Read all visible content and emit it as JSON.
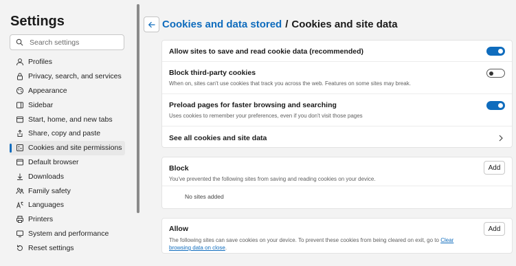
{
  "sidebar": {
    "title": "Settings",
    "search_placeholder": "Search settings",
    "items": [
      {
        "label": "Profiles",
        "icon": "profile-icon"
      },
      {
        "label": "Privacy, search, and services",
        "icon": "lock-icon"
      },
      {
        "label": "Appearance",
        "icon": "appearance-icon"
      },
      {
        "label": "Sidebar",
        "icon": "sidebar-icon"
      },
      {
        "label": "Start, home, and new tabs",
        "icon": "home-icon"
      },
      {
        "label": "Share, copy and paste",
        "icon": "share-icon"
      },
      {
        "label": "Cookies and site permissions",
        "icon": "cookie-icon",
        "active": true
      },
      {
        "label": "Default browser",
        "icon": "browser-icon"
      },
      {
        "label": "Downloads",
        "icon": "download-icon"
      },
      {
        "label": "Family safety",
        "icon": "family-icon"
      },
      {
        "label": "Languages",
        "icon": "language-icon"
      },
      {
        "label": "Printers",
        "icon": "printer-icon"
      },
      {
        "label": "System and performance",
        "icon": "system-icon"
      },
      {
        "label": "Reset settings",
        "icon": "reset-icon"
      }
    ]
  },
  "header": {
    "breadcrumb_link": "Cookies and data stored",
    "separator": "/",
    "current": "Cookies and site data"
  },
  "settings_card": {
    "allow_save": {
      "title": "Allow sites to save and read cookie data (recommended)",
      "enabled": true
    },
    "block_third_party": {
      "title": "Block third-party cookies",
      "description": "When on, sites can't use cookies that track you across the web. Features on some sites may break.",
      "enabled": false
    },
    "preload": {
      "title": "Preload pages for faster browsing and searching",
      "description": "Uses cookies to remember your preferences, even if you don't visit those pages",
      "enabled": true
    },
    "see_all": {
      "title": "See all cookies and site data"
    }
  },
  "block_card": {
    "title": "Block",
    "description": "You've prevented the following sites from saving and reading cookies on your device.",
    "add_label": "Add",
    "empty_text": "No sites added"
  },
  "allow_card": {
    "title": "Allow",
    "description": "The following sites can save cookies on your device. To prevent these cookies from being cleared on exit, go to ",
    "link_text": "Clear browsing data on close",
    "description_end": ".",
    "add_label": "Add"
  },
  "colors": {
    "accent": "#0f6cbd",
    "background": "#f3f3f3",
    "card": "#ffffff"
  }
}
